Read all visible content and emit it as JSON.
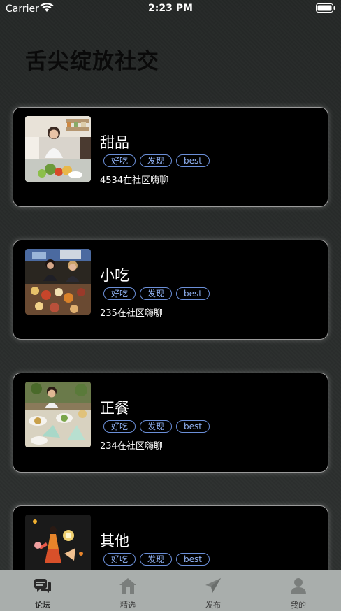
{
  "status_bar": {
    "carrier": "Carrier",
    "time": "2:23 PM"
  },
  "page": {
    "title": "舌尖绽放社交"
  },
  "cards": [
    {
      "title": "甜品",
      "tags": [
        "好吃",
        "发现",
        "best"
      ],
      "count_text": "4534在社区嗨聊",
      "thumb": "kitchen-photo"
    },
    {
      "title": "小吃",
      "tags": [
        "好吃",
        "发现",
        "best"
      ],
      "count_text": "235在社区嗨聊",
      "thumb": "street-food-photo"
    },
    {
      "title": "正餐",
      "tags": [
        "好吃",
        "发现",
        "best"
      ],
      "count_text": "234在社区嗨聊",
      "thumb": "restaurant-photo"
    },
    {
      "title": "其他",
      "tags": [
        "好吃",
        "发现",
        "best"
      ],
      "count_text": "",
      "thumb": "illustration"
    }
  ],
  "tab_bar": {
    "items": [
      {
        "label": "论坛",
        "icon": "chat-icon",
        "active": true
      },
      {
        "label": "精选",
        "icon": "home-icon",
        "active": false
      },
      {
        "label": "发布",
        "icon": "send-icon",
        "active": false
      },
      {
        "label": "我的",
        "icon": "person-icon",
        "active": false
      }
    ]
  },
  "colors": {
    "background": "#2a2d2c",
    "card": "#000000",
    "tag_border": "#6b8fd8",
    "tab_bar": "#a9aeac"
  }
}
